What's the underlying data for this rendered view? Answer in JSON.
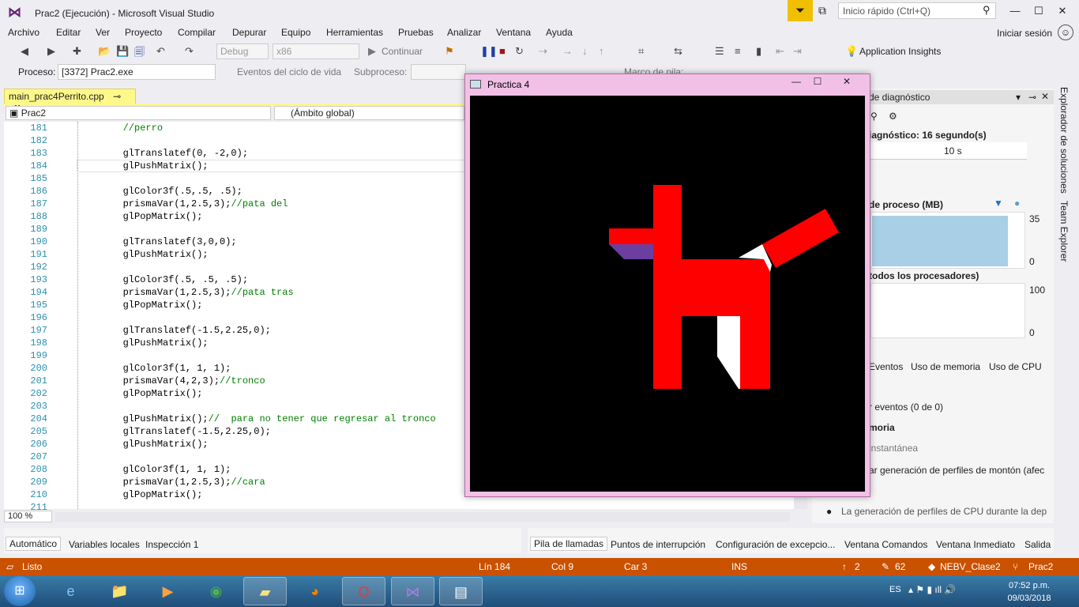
{
  "window": {
    "title": "Prac2 (Ejecución) - Microsoft Visual Studio",
    "quick_launch_placeholder": "Inicio rápido (Ctrl+Q)",
    "minimize": "—",
    "maximize": "☐",
    "close": "✕"
  },
  "menu": [
    "Archivo",
    "Editar",
    "Ver",
    "Proyecto",
    "Compilar",
    "Depurar",
    "Equipo",
    "Herramientas",
    "Pruebas",
    "Analizar",
    "Ventana",
    "Ayuda"
  ],
  "sign_in": "Iniciar sesión",
  "toolbar": {
    "config": "Debug",
    "platform": "x86",
    "continue": "Continuar",
    "app_insights": "Application Insights"
  },
  "debug_location": {
    "process_label": "Proceso:",
    "process_value": "[3372] Prac2.exe",
    "events_label": "Eventos del ciclo de vida",
    "thread_label": "Subproceso:",
    "stack_label": "Marco de pila:"
  },
  "editor": {
    "tab_label": "main_prac4Perrito.cpp",
    "nav_project": "Prac2",
    "nav_scope": "(Ámbito global)",
    "zoom": "100 %",
    "lines": [
      {
        "n": "181",
        "code": "        ",
        "comment": "//perro"
      },
      {
        "n": "182",
        "code": "",
        "comment": ""
      },
      {
        "n": "183",
        "code": "        glTranslatef(0, -2,0);",
        "comment": ""
      },
      {
        "n": "184",
        "code": "        glPushMatrix();",
        "comment": ""
      },
      {
        "n": "185",
        "code": "",
        "comment": ""
      },
      {
        "n": "186",
        "code": "        glColor3f(.5,.5, .5);",
        "comment": ""
      },
      {
        "n": "187",
        "code": "        prismaVar(1,2.5,3);",
        "comment": "//pata del"
      },
      {
        "n": "188",
        "code": "        glPopMatrix();",
        "comment": ""
      },
      {
        "n": "189",
        "code": "",
        "comment": ""
      },
      {
        "n": "190",
        "code": "        glTranslatef(3,0,0);",
        "comment": ""
      },
      {
        "n": "191",
        "code": "        glPushMatrix();",
        "comment": ""
      },
      {
        "n": "192",
        "code": "",
        "comment": ""
      },
      {
        "n": "193",
        "code": "        glColor3f(.5, .5, .5);",
        "comment": ""
      },
      {
        "n": "194",
        "code": "        prismaVar(1,2.5,3);",
        "comment": "//pata tras"
      },
      {
        "n": "195",
        "code": "        glPopMatrix();",
        "comment": ""
      },
      {
        "n": "196",
        "code": "",
        "comment": ""
      },
      {
        "n": "197",
        "code": "        glTranslatef(-1.5,2.25,0);",
        "comment": ""
      },
      {
        "n": "198",
        "code": "        glPushMatrix();",
        "comment": ""
      },
      {
        "n": "199",
        "code": "",
        "comment": ""
      },
      {
        "n": "200",
        "code": "        glColor3f(1, 1, 1);",
        "comment": ""
      },
      {
        "n": "201",
        "code": "        prismaVar(4,2,3);",
        "comment": "//tronco"
      },
      {
        "n": "202",
        "code": "        glPopMatrix();",
        "comment": ""
      },
      {
        "n": "203",
        "code": "",
        "comment": ""
      },
      {
        "n": "204",
        "code": "        glPushMatrix();",
        "comment": "//  para no tener que regresar al tronco"
      },
      {
        "n": "205",
        "code": "        glTranslatef(-1.5,2.25,0);",
        "comment": ""
      },
      {
        "n": "206",
        "code": "        glPushMatrix();",
        "comment": ""
      },
      {
        "n": "207",
        "code": "",
        "comment": ""
      },
      {
        "n": "208",
        "code": "        glColor3f(1, 1, 1);",
        "comment": ""
      },
      {
        "n": "209",
        "code": "        prismaVar(1,2.5,3);",
        "comment": "//cara"
      },
      {
        "n": "210",
        "code": "        glPopMatrix();",
        "comment": ""
      },
      {
        "n": "211",
        "code": "",
        "comment": ""
      }
    ]
  },
  "diagnostics": {
    "header": "de diagnóstico",
    "session": "iagnóstico: 16 segundo(s)",
    "time_tick": "10 s",
    "memory_label": "de proceso (MB)",
    "mem_max": "35",
    "mem_min": "0",
    "cpu_label": "todos los procesadores)",
    "cpu_max": "100",
    "cpu_min": "0",
    "tabs": [
      "Eventos",
      "Uso de memoria",
      "Uso de CPU"
    ],
    "events_line": "r eventos (0 de 0)",
    "memory_section": "moria",
    "snapshot": "instantánea",
    "heap_profiling": "ar generación de perfiles de montón (afec",
    "cpu_note": "La generación de perfiles de CPU durante la dep"
  },
  "side_tabs": [
    "Explorador de soluciones",
    "Team Explorer"
  ],
  "bottom_left_tabs": [
    "Automático",
    "Variables locales",
    "Inspección 1"
  ],
  "bottom_right_tabs": [
    "Pila de llamadas",
    "Puntos de interrupción",
    "Configuración de excepcio...",
    "Ventana Comandos",
    "Ventana Inmediato",
    "Salida"
  ],
  "status": {
    "ready": "Listo",
    "line": "Lín 184",
    "col": "Col 9",
    "car": "Car 3",
    "ins": "INS",
    "up_count": "2",
    "edit_count": "62",
    "repo": "NEBV_Clase2",
    "branch": "Prac2"
  },
  "taskbar": {
    "lang": "ES",
    "time": "07:52 p.m.",
    "date": "09/03/2018"
  },
  "gl_window": {
    "title": "Practica 4"
  },
  "colors": {
    "accent_status": "#ca5100",
    "editor_tab": "#fef88a",
    "dog_body": "#ff0000",
    "dog_shadow": "#6a3fa0"
  }
}
